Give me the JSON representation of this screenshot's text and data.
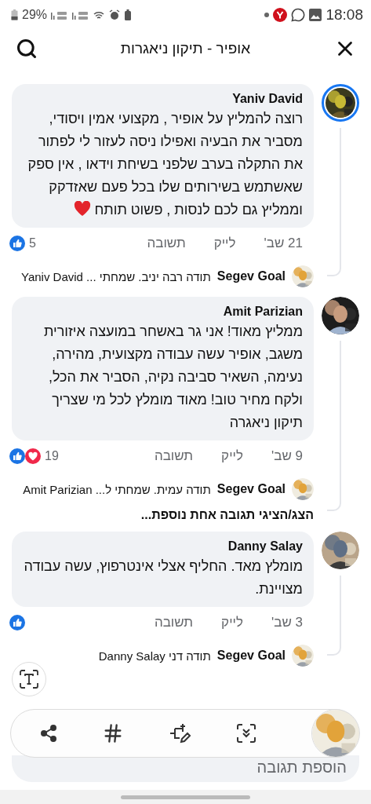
{
  "status_bar": {
    "battery": "29%",
    "time": "18:08"
  },
  "header": {
    "title": "אופיר - תיקון ניאגרות"
  },
  "comments": [
    {
      "author": "Yaniv David",
      "story_ring": true,
      "text": "רוצה להמליץ על אופיר , מקצועי אמין ויסודי, מסביר את הבעיה ואפילו ניסה לעזור לי לפתור את התקלה בערב שלפני בשיחת וידאו , אין ספק שאשתמש בשירותים שלו בכל פעם שאזדקק וממליץ גם לכם לנסות , פשוט תותח",
      "heart": true,
      "date": "21 שב'",
      "like": "לייק",
      "reply": "תשובה",
      "reactions": [
        {
          "kind": "like"
        }
      ],
      "count": "5",
      "replies": [
        {
          "author": "Segev Goal",
          "text": "תודה רבה יניב. שמחתי ... Yaniv David"
        }
      ]
    },
    {
      "author": "Amit Parizian",
      "story_ring": false,
      "text": "ממליץ מאוד! אני גר באשחר במועצה איזורית משגב, אופיר עשה עבודה מקצועית, מהירה, נעימה, השאיר סביבה נקיה, הסביר את הכל, ולקח מחיר טוב! מאוד מומלץ לכל מי שצריך תיקון ניאגרה",
      "heart": false,
      "date": "9 שב'",
      "like": "לייק",
      "reply": "תשובה",
      "reactions": [
        {
          "kind": "love"
        },
        {
          "kind": "like"
        }
      ],
      "count": "19",
      "replies": [
        {
          "author": "Segev Goal",
          "text": "תודה עמית. שמחתי ל... Amit Parizian"
        }
      ],
      "more_replies": "הצג/הציגי תגובה אחת נוספת..."
    },
    {
      "author": "Danny Salay",
      "story_ring": false,
      "text": "מומלץ מאד. החליף אצלי אינטרפוץ, עשה עבודה מצויינת.",
      "heart": false,
      "date": "3 שב'",
      "like": "לייק",
      "reply": "תשובה",
      "reactions": [
        {
          "kind": "like"
        }
      ],
      "replies": [
        {
          "author": "Segev Goal",
          "text": "תודה דני Danny Salay"
        }
      ]
    }
  ],
  "comment_box": {
    "placeholder": "הוספת תגובה"
  }
}
